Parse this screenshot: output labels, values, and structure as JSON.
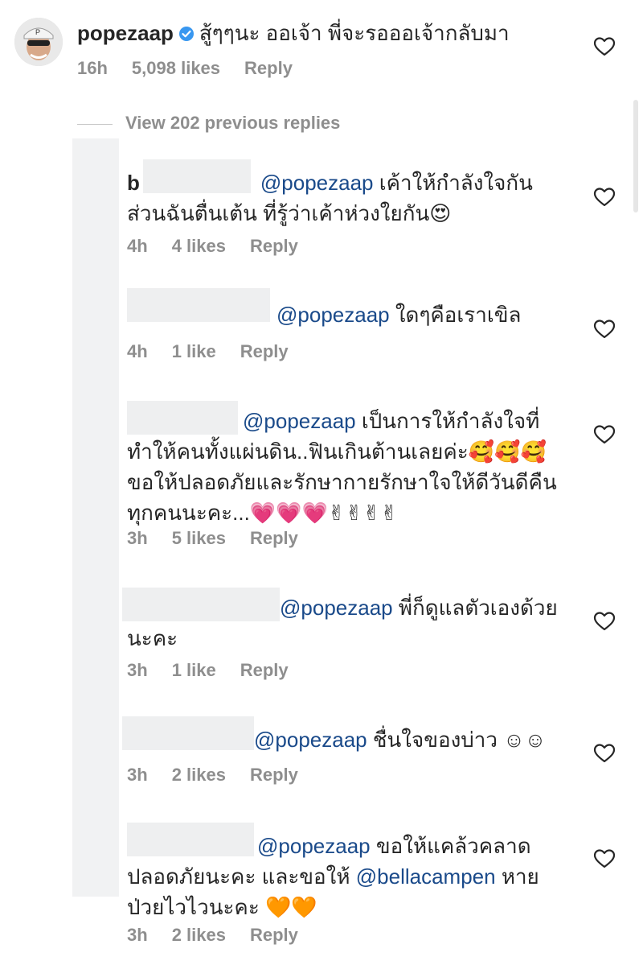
{
  "top_comment": {
    "username": "popezaap",
    "text": "สู้ๆๆนะ ออเจ้า พี่จะรอออเจ้ากลับมา",
    "time": "16h",
    "likes": "5,098 likes",
    "reply": "Reply"
  },
  "view_replies": "View 202 previous replies",
  "replies": [
    {
      "prefix": "b",
      "mention": "@popezaap",
      "line1": "เค้าให้กำลังใจกัน",
      "line2": "ส่วนฉันตื่นเต้น ที่รู้ว่าเค้าห่วงใยกัน😍",
      "time": "4h",
      "likes": "4 likes",
      "reply": "Reply"
    },
    {
      "mention": "@popezaap",
      "line1": "ใดๆคือเราเขิล",
      "time": "4h",
      "likes": "1 like",
      "reply": "Reply"
    },
    {
      "mention": "@popezaap",
      "line1": "เป็นการให้กำลังใจที่",
      "line2": "ทำให้คนทั้งแผ่นดิน..ฟินเกินต้านเลยค่ะ🥰🥰🥰",
      "line3": "ขอให้ปลอดภัยและรักษากายรักษาใจให้ดีวันดีคืน",
      "line4": "ทุกคนนะคะ...💗💗💗✌✌✌✌",
      "time": "3h",
      "likes": "5 likes",
      "reply": "Reply"
    },
    {
      "mention": "@popezaap",
      "line1": "พี่ก็ดูแลตัวเองด้วย",
      "line2": "นะคะ",
      "time": "3h",
      "likes": "1 like",
      "reply": "Reply"
    },
    {
      "mention": "@popezaap",
      "line1": "ชื่นใจของบ่าว ☺☺",
      "time": "3h",
      "likes": "2 likes",
      "reply": "Reply"
    },
    {
      "mention": "@popezaap",
      "line1": "ขอให้แคล้วคลาด",
      "line2_a": "ปลอดภัยนะคะ และขอให้",
      "line2_mention": "@bellacampen",
      "line2_b": "หาย",
      "line3": "ป่วยไวไวนะคะ 🧡🧡",
      "time": "3h",
      "likes": "2 likes",
      "reply": "Reply"
    }
  ],
  "icons": {
    "heart": "heart-outline-icon",
    "verified": "verified-badge-icon"
  },
  "colors": {
    "mention": "#1a4a8a",
    "meta": "#8e8e8e",
    "verified": "#3897f0"
  }
}
